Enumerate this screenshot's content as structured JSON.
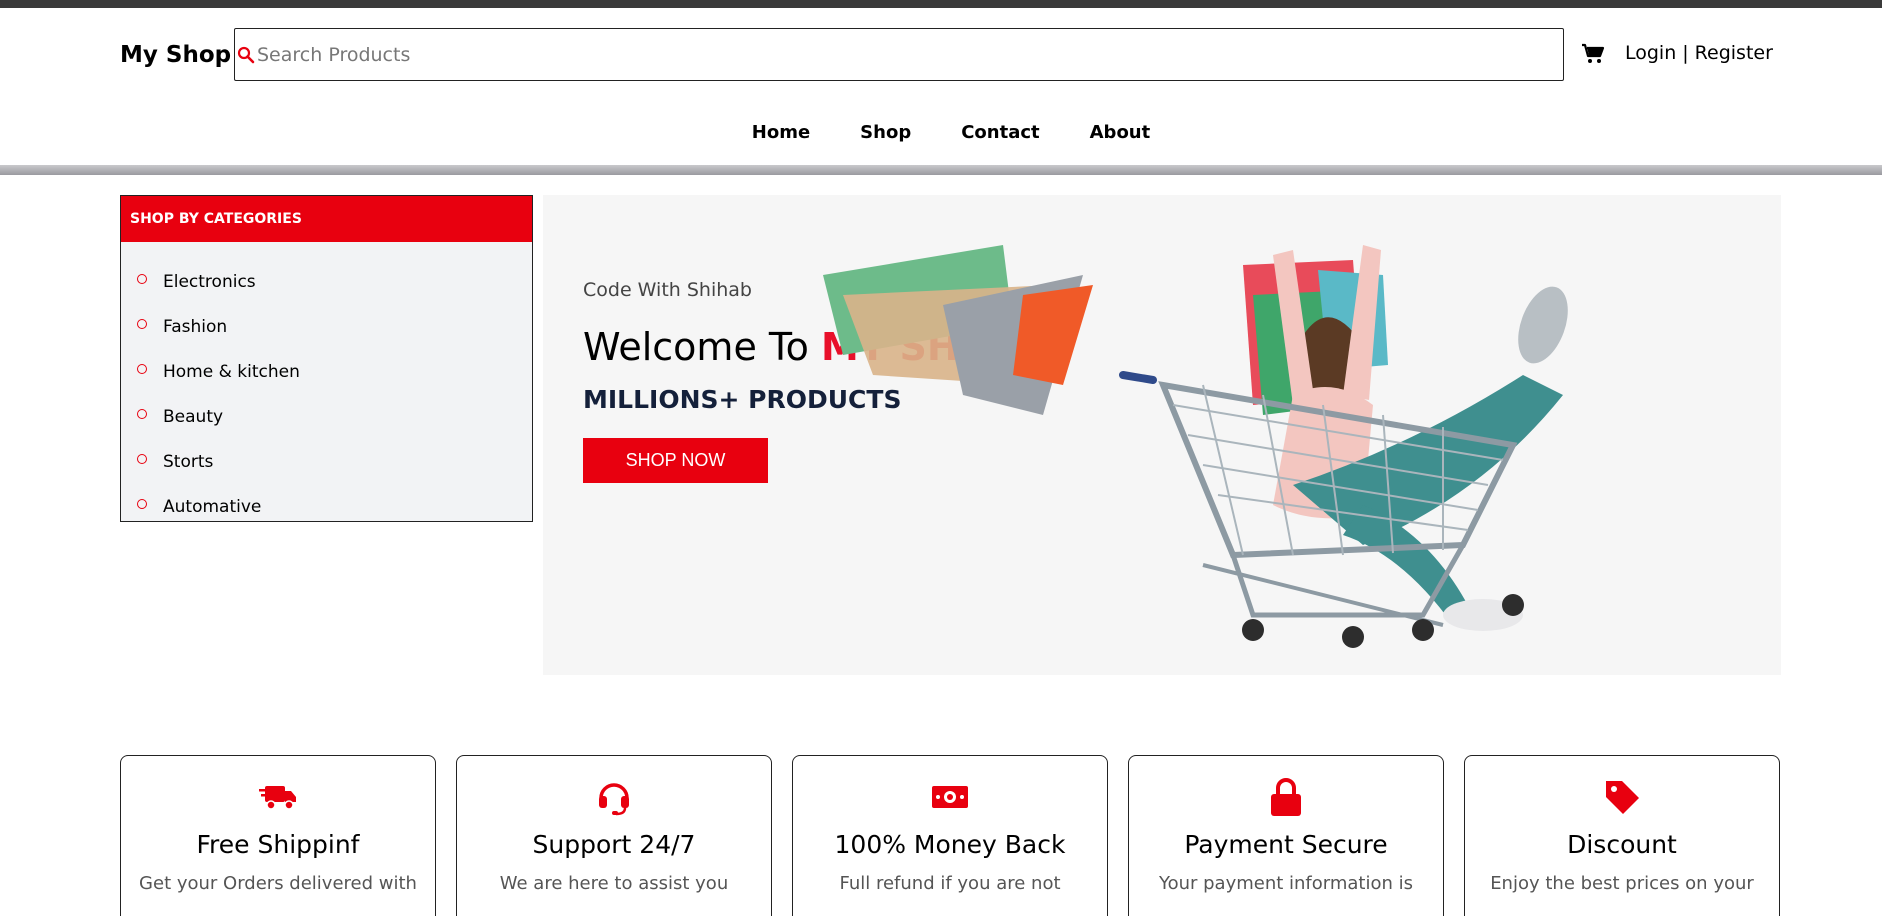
{
  "header": {
    "logo": "My Shop",
    "search_placeholder": "Search Products",
    "login_label": "Login",
    "separator": "|",
    "register_label": "Register"
  },
  "nav": {
    "items": [
      {
        "label": "Home"
      },
      {
        "label": "Shop"
      },
      {
        "label": "Contact"
      },
      {
        "label": "About"
      }
    ]
  },
  "categories": {
    "heading": "SHOP BY CATEGORIES",
    "items": [
      {
        "label": "Electronics"
      },
      {
        "label": "Fashion"
      },
      {
        "label": "Home & kitchen"
      },
      {
        "label": "Beauty"
      },
      {
        "label": "Storts"
      },
      {
        "label": "Automative"
      }
    ]
  },
  "hero": {
    "subtitle": "Code With Shihab",
    "title_prefix": "Welcome To",
    "title_highlight": "MY SHOP",
    "tagline": "MILLIONS+ PRODUCTS",
    "cta_label": "SHOP NOW"
  },
  "features": [
    {
      "icon": "truck-icon",
      "title": "Free Shippinf",
      "desc": "Get your Orders delivered with"
    },
    {
      "icon": "headset-icon",
      "title": "Support 24/7",
      "desc": "We are here to assist you"
    },
    {
      "icon": "money-icon",
      "title": "100% Money Back",
      "desc": "Full refund if you are not"
    },
    {
      "icon": "lock-icon",
      "title": "Payment Secure",
      "desc": "Your payment information is"
    },
    {
      "icon": "tag-icon",
      "title": "Discount",
      "desc": "Enjoy the best prices on your"
    }
  ],
  "colors": {
    "accent": "#e8000f",
    "topbar": "#3a3a3a",
    "sidebar_bg": "#f2f3f5"
  }
}
